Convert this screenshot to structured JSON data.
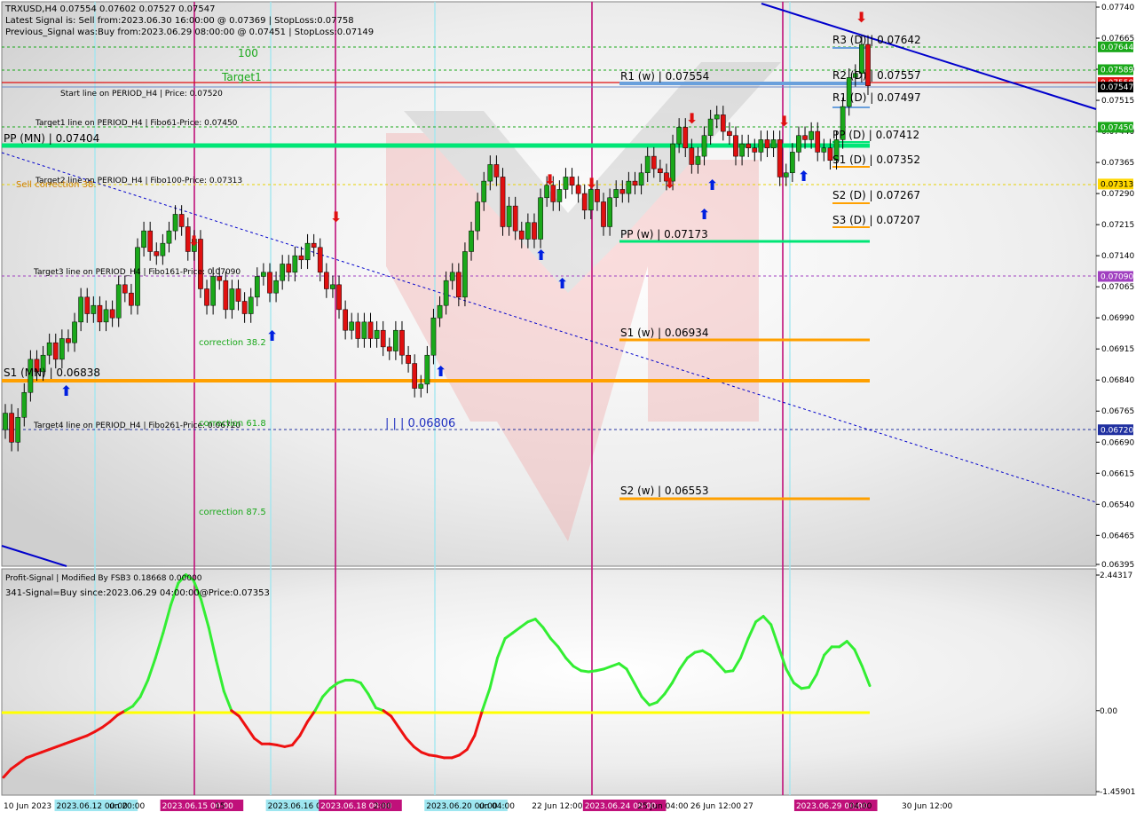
{
  "header": {
    "symbol_line": "TRXUSD,H4  0.07554 0.07602 0.07527 0.07547",
    "latest_signal": "Latest Signal is: Sell from:2023.06.30 16:00:00 @ 0.07369 | StopLoss:0.07758",
    "previous_signal": "Previous_Signal was:Buy from:2023.06.29 08:00:00 @ 0.07451 | StopLoss:0.07149"
  },
  "indicator": {
    "title": "Profit-Signal | Modified By FSB3 0.18668 0.00000",
    "signal": "341-Signal=Buy since:2023.06.29 04:00:00@Price:0.07353"
  },
  "colors": {
    "background": "#ffffff",
    "bull": "#1aa81a",
    "bear": "#e01010",
    "pivot_green": "#00e676",
    "support_orange": "#ffa000",
    "trend_blue": "#0000cc",
    "cyan_line": "#9ee6f0",
    "magenta_line": "#c0107a",
    "osc_green": "#33ee33",
    "osc_red": "#ee1111",
    "osc_zero": "#ffff00"
  },
  "chart_data": [
    {
      "type": "candlestick",
      "title": "TRXUSD,H4",
      "ylim": [
        0.06395,
        0.0774
      ],
      "y_ticks": [
        "0.07740",
        "0.07665",
        "0.07590",
        "0.07515",
        "0.07440",
        "0.07365",
        "0.07290",
        "0.07215",
        "0.07140",
        "0.07065",
        "0.06990",
        "0.06915",
        "0.06840",
        "0.06765",
        "0.06690",
        "0.06615",
        "0.06540",
        "0.06465",
        "0.06395"
      ],
      "x_labels": [
        "10 Jun 2023",
        "2023.06.12 00:00",
        "un 20:00",
        "2023.06.15 00:00",
        "15",
        "2023.06.16 00:00",
        "2023.06.18 08:00",
        "2:00",
        "2023.06.20 00:00",
        "un 04:00",
        "22 Jun 12:00",
        "2023.06.24 08:00",
        "25 Jun 04:00",
        "26 Jun 12:00",
        "27",
        "2023.06.29 00:00",
        "04:00",
        "30 Jun 12:00"
      ],
      "close": [
        0.0676,
        0.0669,
        0.0675,
        0.0681,
        0.0689,
        0.0686,
        0.069,
        0.0693,
        0.0689,
        0.0694,
        0.0693,
        0.0698,
        0.0704,
        0.07,
        0.0702,
        0.0698,
        0.0701,
        0.0699,
        0.0707,
        0.0705,
        0.0702,
        0.0716,
        0.072,
        0.0715,
        0.0714,
        0.0717,
        0.072,
        0.0724,
        0.0721,
        0.0715,
        0.0718,
        0.0706,
        0.0702,
        0.0709,
        0.0708,
        0.0701,
        0.0706,
        0.0703,
        0.07,
        0.0704,
        0.0709,
        0.071,
        0.0705,
        0.0708,
        0.0712,
        0.071,
        0.0714,
        0.0713,
        0.0717,
        0.0716,
        0.071,
        0.0706,
        0.0707,
        0.0701,
        0.0696,
        0.0698,
        0.0694,
        0.0698,
        0.0694,
        0.0696,
        0.0692,
        0.0691,
        0.0696,
        0.069,
        0.0688,
        0.0682,
        0.0683,
        0.069,
        0.0699,
        0.0702,
        0.0708,
        0.071,
        0.0704,
        0.0715,
        0.072,
        0.0727,
        0.0732,
        0.0736,
        0.0733,
        0.0721,
        0.0726,
        0.072,
        0.0718,
        0.0722,
        0.0718,
        0.0728,
        0.0731,
        0.0727,
        0.073,
        0.0733,
        0.0731,
        0.0729,
        0.0725,
        0.073,
        0.0727,
        0.0721,
        0.0728,
        0.073,
        0.0729,
        0.0732,
        0.0731,
        0.0734,
        0.0738,
        0.0735,
        0.0734,
        0.0732,
        0.0741,
        0.0745,
        0.074,
        0.0736,
        0.0738,
        0.0743,
        0.0747,
        0.0748,
        0.0744,
        0.0743,
        0.0738,
        0.0741,
        0.074,
        0.0739,
        0.0742,
        0.074,
        0.0742,
        0.0733,
        0.0734,
        0.0739,
        0.0743,
        0.0742,
        0.0744,
        0.0739,
        0.074,
        0.0737,
        0.0742,
        0.075,
        0.0757,
        0.0758,
        0.0765,
        0.0755
      ],
      "annotations": [
        "Start line on PERIOD_H4 | Price: 0.07520",
        "Target1 line on PERIOD_H4 | Fibo61-Price: 0.07450",
        "Target2 line on PERIOD_H4 | Fibo100-Price: 0.07313",
        "Target3 line on PERIOD_H4 | Fibo161-Price: 0.07090",
        "Target4 line on PERIOD_H4 | Fibo261-Price: 0.06720",
        "Sell correction 38.",
        "100",
        "Target1",
        "correction 38.2",
        "correction 61.8",
        "correction 87.5",
        "| | | 0.06806"
      ],
      "levels": [
        {
          "label": "PP (MN) | 0.07404",
          "value": 0.07404
        },
        {
          "label": "S1 (MN) | 0.06838",
          "value": 0.06838
        },
        {
          "label": "R1 (w) | 0.07554",
          "value": 0.07554
        },
        {
          "label": "PP (w) | 0.07173",
          "value": 0.07173
        },
        {
          "label": "S1 (w) | 0.06934",
          "value": 0.06934
        },
        {
          "label": "S2 (w) | 0.06553",
          "value": 0.06553
        },
        {
          "label": "R3 (D) | 0.07642",
          "value": 0.07642
        },
        {
          "label": "R2 (D) | 0.07557",
          "value": 0.07557
        },
        {
          "label": "R1 (D) | 0.07497",
          "value": 0.07497
        },
        {
          "label": "PP (D) | 0.07412",
          "value": 0.07412
        },
        {
          "label": "S1 (D) | 0.07352",
          "value": 0.07352
        },
        {
          "label": "S2 (D) | 0.07267",
          "value": 0.07267
        },
        {
          "label": "S3 (D) | 0.07207",
          "value": 0.07207
        }
      ],
      "price_tags": [
        {
          "text": "0.07644",
          "value": 0.07644,
          "color": "#1aa81a"
        },
        {
          "text": "0.07589",
          "value": 0.07589,
          "color": "#1aa81a"
        },
        {
          "text": "0.07558",
          "value": 0.07558,
          "color": "#e01010"
        },
        {
          "text": "0.07547",
          "value": 0.07547,
          "color": "#000000"
        },
        {
          "text": "0.07450",
          "value": 0.0745,
          "color": "#1aa81a"
        },
        {
          "text": "0.07313",
          "value": 0.07313,
          "color": "#ffd800"
        },
        {
          "text": "0.07090",
          "value": 0.0709,
          "color": "#a040c0"
        },
        {
          "text": "0.06720",
          "value": 0.0672,
          "color": "#2030a0"
        }
      ]
    },
    {
      "type": "line",
      "title": "Profit-Signal",
      "ylim": [
        -1.45901,
        2.44317
      ],
      "y_ticks": [
        "2.44317",
        "0.00",
        "-1.45901"
      ],
      "series": [
        {
          "values": [
            -1.2,
            -1.05,
            -0.95,
            -0.85,
            -0.8,
            -0.75,
            -0.7,
            -0.65,
            -0.6,
            -0.55,
            -0.5,
            -0.45,
            -0.38,
            -0.3,
            -0.2,
            -0.08,
            0.0,
            0.08,
            0.25,
            0.55,
            0.95,
            1.4,
            1.9,
            2.3,
            2.45,
            2.35,
            2.0,
            1.5,
            0.9,
            0.35,
            0.0,
            -0.1,
            -0.3,
            -0.5,
            -0.6,
            -0.6,
            -0.62,
            -0.65,
            -0.62,
            -0.45,
            -0.2,
            0.0,
            0.25,
            0.4,
            0.5,
            0.55,
            0.55,
            0.5,
            0.3,
            0.05,
            0.0,
            -0.1,
            -0.3,
            -0.5,
            -0.65,
            -0.75,
            -0.8,
            -0.82,
            -0.85,
            -0.85,
            -0.8,
            -0.7,
            -0.45,
            0.0,
            0.4,
            0.95,
            1.3,
            1.4,
            1.5,
            1.6,
            1.65,
            1.5,
            1.3,
            1.15,
            0.95,
            0.8,
            0.72,
            0.7,
            0.72,
            0.75,
            0.8,
            0.85,
            0.75,
            0.5,
            0.25,
            0.1,
            0.15,
            0.3,
            0.5,
            0.75,
            0.95,
            1.05,
            1.08,
            1.0,
            0.85,
            0.7,
            0.72,
            0.95,
            1.3,
            1.6,
            1.7,
            1.55,
            1.15,
            0.75,
            0.5,
            0.4,
            0.42,
            0.65,
            1.0,
            1.15,
            1.15,
            1.25,
            1.1,
            0.8,
            0.45
          ]
        }
      ]
    }
  ]
}
